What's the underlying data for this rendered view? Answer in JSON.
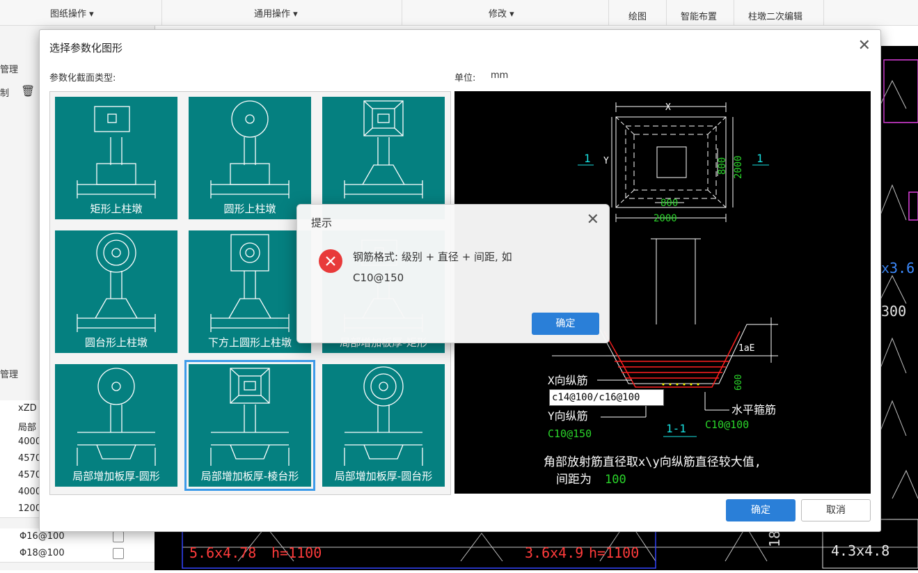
{
  "ribbon": {
    "groups": [
      {
        "label": "图纸操作 ▾"
      },
      {
        "label": "通用操作 ▾"
      },
      {
        "label": "修改 ▾"
      },
      {
        "label": "绘图"
      },
      {
        "label": "智能布置"
      },
      {
        "label": "柱墩二次编辑"
      }
    ]
  },
  "left_panel": {
    "tab_top": "管理",
    "toolbar_copy": "制",
    "tab_bottom": "管理",
    "col_header": "xZD",
    "col_header2": "局部",
    "rows": [
      "4000",
      "4570",
      "4570",
      "4000",
      "1200"
    ],
    "rebar_rows": [
      "Φ16@100",
      "Φ18@100"
    ]
  },
  "dialog": {
    "title": "选择参数化图形",
    "section_label": "参数化截面类型:",
    "unit_label": "单位:",
    "unit_value": "mm",
    "ok_label": "确定",
    "cancel_label": "取消",
    "tiles": [
      {
        "label": "矩形上柱墩",
        "top_shape": "rect",
        "base": "rect"
      },
      {
        "label": "圆形上柱墩",
        "top_shape": "circle",
        "base": "rect"
      },
      {
        "label": "",
        "top_shape": "frustum",
        "base": "trapezoid"
      },
      {
        "label": "圆台形上柱墩",
        "top_shape": "circle2",
        "base": "trapezoid"
      },
      {
        "label": "下方上圆形上柱墩",
        "top_shape": "sqcircle",
        "base": "trapezoid"
      },
      {
        "label": "局部增加板厚-矩形",
        "top_shape": "rect",
        "base": "trapezoid"
      },
      {
        "label": "局部增加板厚-圆形",
        "top_shape": "circle",
        "base": "under"
      },
      {
        "label": "局部增加板厚-棱台形",
        "top_shape": "frustum",
        "base": "under"
      },
      {
        "label": "局部增加板厚-圆台形",
        "top_shape": "circle2",
        "base": "under"
      }
    ],
    "selected_index": 7
  },
  "preview": {
    "dim_x": "X",
    "dim_y": "Y",
    "section_mark": "1",
    "dim_800": "800",
    "dim_2000": "2000",
    "section_title": "1-1",
    "label_x_rebar": "X向纵筋",
    "label_y_rebar": "Y向纵筋",
    "label_hoop": "水平箍筋",
    "rebar_input_value": "c14@100/c16@100",
    "value_y_rebar": "C10@150",
    "value_hoop": "C10@100",
    "label_lae": "1aE",
    "dim_600": "600",
    "note_line1": "角部放射筋直径取x\\y向纵筋直径较大值,",
    "note_line2_prefix": "间距为",
    "note_line2_value": "100",
    "colors": {
      "white": "#ffffff",
      "green": "#2ad42a",
      "cyan": "#19e0e0",
      "red": "#ff2020",
      "yellow": "#ffff00"
    }
  },
  "alert": {
    "title": "提示",
    "message_line1": "钢筋格式: 级别 + 直径 + 间距, 如",
    "message_line2": "C10@150",
    "ok_label": "确定",
    "icon": "error-icon"
  },
  "cad": {
    "labels": [
      "5.6x4.78",
      "h=1100",
      "3.6x4.9",
      "h=1100",
      "180",
      "4.3x4.8",
      "x3.6",
      "300"
    ]
  }
}
